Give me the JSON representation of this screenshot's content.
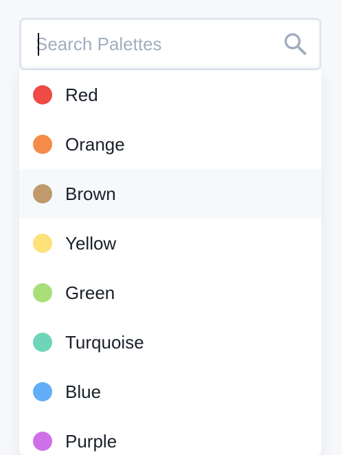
{
  "search": {
    "placeholder": "Search Palettes",
    "value": ""
  },
  "palettes": [
    {
      "label": "Red",
      "color": "#ef4a45",
      "active": false
    },
    {
      "label": "Orange",
      "color": "#f58b48",
      "active": false
    },
    {
      "label": "Brown",
      "color": "#c09a6b",
      "active": true
    },
    {
      "label": "Yellow",
      "color": "#fde27a",
      "active": false
    },
    {
      "label": "Green",
      "color": "#a9df7b",
      "active": false
    },
    {
      "label": "Turquoise",
      "color": "#6ed5b8",
      "active": false
    },
    {
      "label": "Blue",
      "color": "#62adf7",
      "active": false
    },
    {
      "label": "Purple",
      "color": "#d070e8",
      "active": false
    }
  ]
}
